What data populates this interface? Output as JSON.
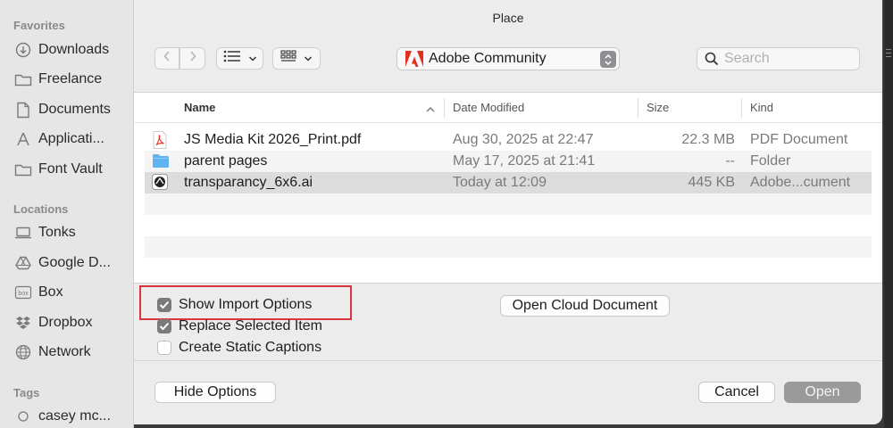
{
  "window": {
    "title": "Place"
  },
  "sidebar": {
    "favorites_heading": "Favorites",
    "favorites": [
      {
        "label": "Downloads",
        "icon": "download-circle-icon"
      },
      {
        "label": "Freelance",
        "icon": "folder-icon"
      },
      {
        "label": "Documents",
        "icon": "document-icon"
      },
      {
        "label": "Applicati...",
        "icon": "applications-icon"
      },
      {
        "label": "Font Vault",
        "icon": "folder-icon"
      }
    ],
    "locations_heading": "Locations",
    "locations": [
      {
        "label": "Tonks",
        "icon": "laptop-icon"
      },
      {
        "label": "Google D...",
        "icon": "google-drive-icon"
      },
      {
        "label": "Box",
        "icon": "box-icon"
      },
      {
        "label": "Dropbox",
        "icon": "dropbox-icon"
      },
      {
        "label": "Network",
        "icon": "globe-icon"
      }
    ],
    "tags_heading": "Tags",
    "tags": [
      {
        "label": "casey mc...",
        "icon": "tag-circle-icon"
      }
    ]
  },
  "toolbar": {
    "location": "Adobe Community",
    "location_icon": "adobe-logo-icon",
    "search_placeholder": "Search"
  },
  "filelist": {
    "columns": {
      "name": "Name",
      "date": "Date Modified",
      "size": "Size",
      "kind": "Kind"
    },
    "rows": [
      {
        "name": "JS Media Kit 2026_Print.pdf",
        "date": "Aug 30, 2025 at 22:47",
        "size": "22.3 MB",
        "kind": "PDF Document",
        "icon": "pdf-file-icon"
      },
      {
        "name": "parent pages",
        "date": "May 17, 2025 at 21:41",
        "size": "--",
        "kind": "Folder",
        "icon": "folder-icon"
      },
      {
        "name": "transparancy_6x6.ai",
        "date": "Today at 12:09",
        "size": "445 KB",
        "kind": "Adobe...cument",
        "icon": "illustrator-file-icon"
      }
    ]
  },
  "options": {
    "show_import": {
      "label": "Show Import Options",
      "checked": true
    },
    "replace_selected": {
      "label": "Replace Selected Item",
      "checked": true
    },
    "static_captions": {
      "label": "Create Static Captions",
      "checked": false
    },
    "open_cloud": "Open Cloud Document"
  },
  "footer": {
    "hide_options": "Hide Options",
    "cancel": "Cancel",
    "open": "Open"
  },
  "colors": {
    "highlight": "#d9363e",
    "adobe_red": "#e3301f",
    "folder_blue": "#5fb4f0"
  }
}
